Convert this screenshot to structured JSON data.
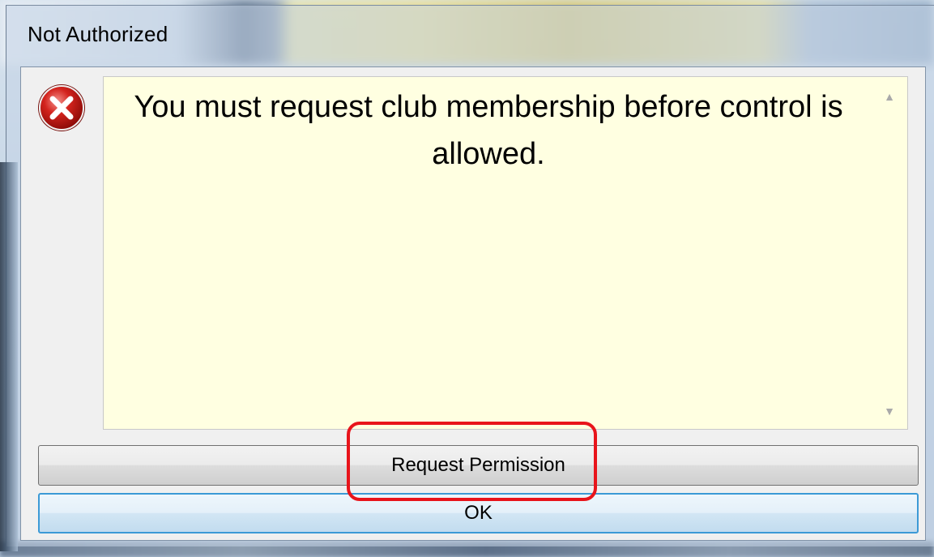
{
  "window": {
    "title": "Not Authorized"
  },
  "message": {
    "icon": "error-icon",
    "text": "You must request club membership before control is allowed."
  },
  "buttons": {
    "request_permission": "Request Permission",
    "ok": "OK"
  },
  "colors": {
    "message_background": "#ffffe1",
    "highlight_border": "#e8141b",
    "default_button_border": "#3c9ad6"
  }
}
